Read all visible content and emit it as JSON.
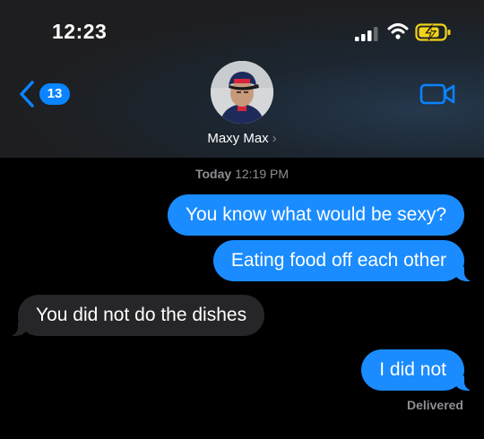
{
  "status_bar": {
    "time": "12:23",
    "icons": [
      "signal-bars-icon",
      "wifi-icon",
      "battery-charging-icon"
    ]
  },
  "header": {
    "back_badge": "13",
    "contact_name": "Maxy Max",
    "contact_chevron": "›",
    "back_icon": "chevron-left-icon",
    "video_icon": "video-camera-icon",
    "accent": "#0a84ff"
  },
  "timestamp": {
    "day": "Today",
    "time": "12:19 PM"
  },
  "messages": [
    {
      "from": "me",
      "text": "You know what would be sexy?"
    },
    {
      "from": "me",
      "text": "Eating food off each other"
    },
    {
      "from": "them",
      "text": "You did not do the dishes"
    },
    {
      "from": "me",
      "text": "I did not"
    }
  ],
  "receipt": "Delivered",
  "colors": {
    "sent_bubble": "#1a8cff",
    "received_bubble": "#262628",
    "background": "#000000"
  }
}
